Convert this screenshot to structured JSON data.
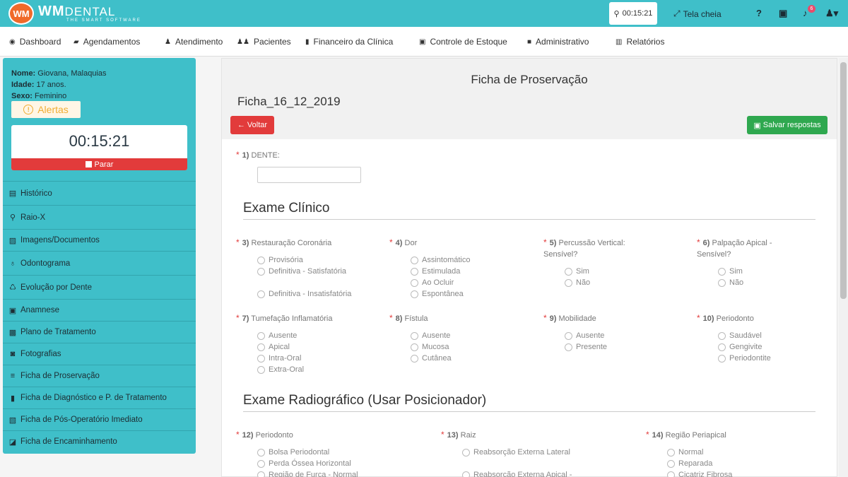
{
  "brand": {
    "mark": "WM",
    "name": "WM",
    "name_suffix": "DENTAL",
    "tagline": "THE SMART SOFTWARE"
  },
  "header": {
    "timer": "00:15:21",
    "fullscreen": "Tela cheia",
    "notif_count": "6"
  },
  "nav": [
    {
      "label": "Dashboard",
      "icon": "dashboard-icon",
      "glyph": "◉"
    },
    {
      "label": "Agendamentos",
      "icon": "book-icon",
      "glyph": "▰"
    },
    {
      "label": "Atendimento",
      "icon": "user-md-icon",
      "glyph": "♟"
    },
    {
      "label": "Pacientes",
      "icon": "users-icon",
      "glyph": "♟♟"
    },
    {
      "label": "Financeiro da Clínica",
      "icon": "bookmark-icon",
      "glyph": "▮"
    },
    {
      "label": "Controle de Estoque",
      "icon": "archive-icon",
      "glyph": "▣"
    },
    {
      "label": "Administrativo",
      "icon": "lock-icon",
      "glyph": "■"
    },
    {
      "label": "Relatórios",
      "icon": "bar-chart-icon",
      "glyph": "▥"
    }
  ],
  "patient": {
    "name_label": "Nome:",
    "name": "Giovana, Malaquias",
    "age_label": "Idade:",
    "age": "17 anos.",
    "sex_label": "Sexo:",
    "sex": "Feminino",
    "alerts": "Alertas"
  },
  "session": {
    "timer": "00:15:21",
    "stop": "Parar"
  },
  "sidebar": [
    {
      "label": "Histórico",
      "glyph": "▤",
      "icon": "file-list-icon"
    },
    {
      "label": "Raio-X",
      "glyph": "⚲",
      "icon": "xray-icon"
    },
    {
      "label": "Imagens/Documentos",
      "glyph": "▨",
      "icon": "image-icon"
    },
    {
      "label": "Odontograma",
      "glyph": "♁",
      "icon": "tooth-icon"
    },
    {
      "label": "Evolução por Dente",
      "glyph": "♺",
      "icon": "tooth-evolution-icon"
    },
    {
      "label": "Anamnese",
      "glyph": "▣",
      "icon": "id-card-icon"
    },
    {
      "label": "Plano de Tratamento",
      "glyph": "▩",
      "icon": "money-icon"
    },
    {
      "label": "Fotografias",
      "glyph": "◙",
      "icon": "camera-icon"
    },
    {
      "label": "Ficha de Proservação",
      "glyph": "≡",
      "icon": "list-icon"
    },
    {
      "label": "Ficha de Diagnóstico e P. de Tratamento",
      "glyph": "▮",
      "icon": "book-icon"
    },
    {
      "label": "Ficha de Pós-Operatório Imediato",
      "glyph": "▧",
      "icon": "copy-icon"
    },
    {
      "label": "Ficha de Encaminhamento",
      "glyph": "◪",
      "icon": "external-link-icon"
    }
  ],
  "form": {
    "title": "Ficha de Proservação",
    "name": "Ficha_16_12_2019",
    "back": "Voltar",
    "save": "Salvar respostas",
    "q1": {
      "num": "1)",
      "label": "DENTE:"
    },
    "section1": "Exame Clínico",
    "section2": "Exame Radiográfico (Usar Posicionador)",
    "questions": [
      {
        "num": "3)",
        "label": "Restauração Coronária",
        "options": [
          "Provisória",
          "Definitiva - Satisfatória",
          "Definitiva - Insatisfatória"
        ]
      },
      {
        "num": "4)",
        "label": "Dor",
        "options": [
          "Assintomático",
          "Estimulada",
          "Ao Ocluir",
          "Espontânea"
        ]
      },
      {
        "num": "5)",
        "label": "Percussão Vertical: Sensível?",
        "options": [
          "Sim",
          "Não"
        ]
      },
      {
        "num": "6)",
        "label": "Palpação Apical - Sensível?",
        "options": [
          "Sim",
          "Não"
        ]
      },
      {
        "num": "7)",
        "label": "Tumefação Inflamatória",
        "options": [
          "Ausente",
          "Apical",
          "Intra-Oral",
          "Extra-Oral"
        ]
      },
      {
        "num": "8)",
        "label": "Fístula",
        "options": [
          "Ausente",
          "Mucosa",
          "Cutânea"
        ]
      },
      {
        "num": "9)",
        "label": "Mobilidade",
        "options": [
          "Ausente",
          "Presente"
        ]
      },
      {
        "num": "10)",
        "label": "Periodonto",
        "options": [
          "Saudável",
          "Gengivite",
          "Periodontite"
        ]
      },
      {
        "num": "12)",
        "label": "Periodonto",
        "options": [
          "Bolsa Periodontal",
          "Perda Óssea Horizontal",
          "Região de Furca - Normal"
        ]
      },
      {
        "num": "13)",
        "label": "Raiz",
        "options": [
          "Reabsorção Externa Lateral",
          "Reabsorção Externa Apical - Arredondada"
        ]
      },
      {
        "num": "14)",
        "label": "Região Periapical",
        "options": [
          "Normal",
          "Reparada",
          "Cicatriz Fibrosa"
        ]
      }
    ]
  }
}
